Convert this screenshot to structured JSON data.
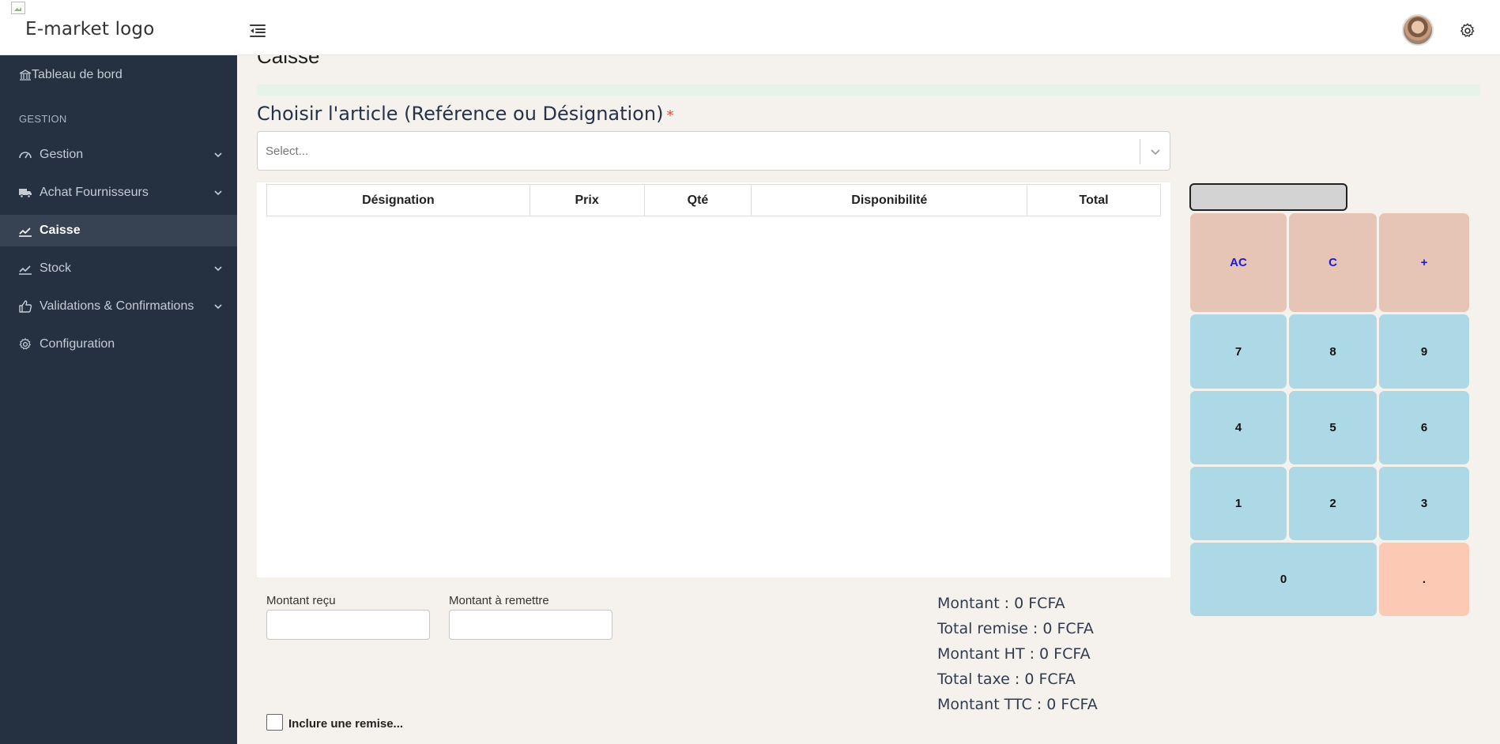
{
  "header": {
    "logo_alt": "E-market logo",
    "menu_toggle_icon": "indent-menu-icon",
    "avatar_icon": "user-avatar",
    "settings_icon": "gear-icon"
  },
  "sidebar": {
    "dashboard": "Tableau de bord",
    "section": "GESTION",
    "items": [
      {
        "label": "Gestion",
        "icon": "gauge-icon",
        "has_chevron": true
      },
      {
        "label": "Achat Fournisseurs",
        "icon": "truck-icon",
        "has_chevron": true
      },
      {
        "label": "Caisse",
        "icon": "chart-line-icon",
        "has_chevron": false,
        "active": true
      },
      {
        "label": "Stock",
        "icon": "chart-line-icon",
        "has_chevron": true
      },
      {
        "label": "Validations & Confirmations",
        "icon": "thumbs-up-icon",
        "has_chevron": true
      },
      {
        "label": "Configuration",
        "icon": "gear-icon",
        "has_chevron": false
      }
    ]
  },
  "main": {
    "page_title": "Caisse",
    "article_label": "Choisir l'article (Reférence ou Désignation)",
    "required_mark": "*",
    "select_placeholder": "Select...",
    "table_headers": [
      "Désignation",
      "Prix",
      "Qté",
      "Disponibilité",
      "Total"
    ],
    "montant_recu_label": "Montant reçu",
    "montant_remettre_label": "Montant à remettre",
    "montant_recu_value": "",
    "montant_remettre_value": "",
    "totals": {
      "montant": "Montant : 0 FCFA",
      "remise": "Total remise : 0 FCFA",
      "ht": "Montant HT : 0 FCFA",
      "taxe": "Total taxe : 0 FCFA",
      "ttc": "Montant TTC : 0 FCFA"
    },
    "remise_checkbox_label": "Inclure une remise...",
    "remise_checked": false
  },
  "calculator": {
    "display_value": "",
    "keys": {
      "ac": "AC",
      "c": "C",
      "plus": "+",
      "k7": "7",
      "k8": "8",
      "k9": "9",
      "k4": "4",
      "k5": "5",
      "k6": "6",
      "k1": "1",
      "k2": "2",
      "k3": "3",
      "k0": "0",
      "dot": "."
    }
  },
  "colors": {
    "sidebar_bg": "#253040",
    "active_bg": "#374253",
    "page_bg": "#f5f2ed",
    "key_number": "#add8e6",
    "key_operator": "#e6c4b6",
    "key_dot": "#fbc9b4",
    "operator_text": "#1a1adb"
  }
}
